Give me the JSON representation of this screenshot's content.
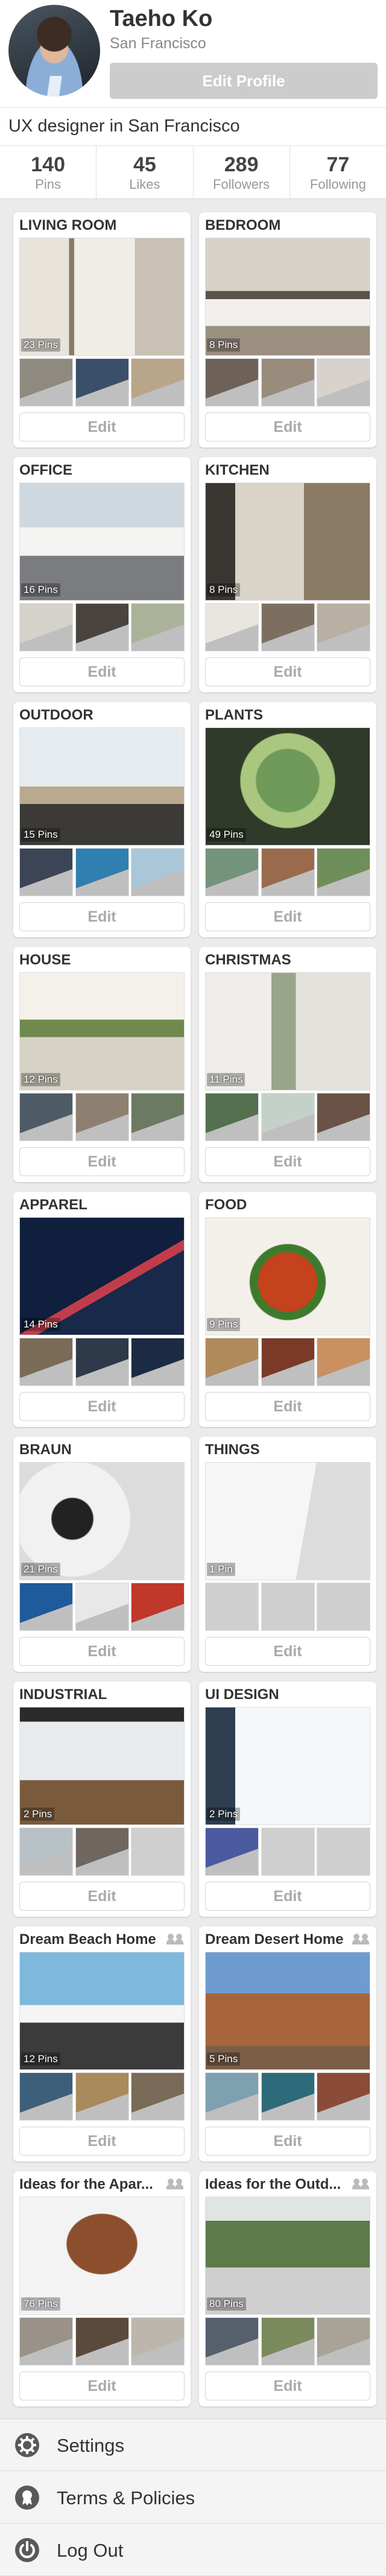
{
  "profile": {
    "name": "Taeho Ko",
    "location": "San Francisco",
    "edit_label": "Edit Profile",
    "bio": "UX designer in San Francisco"
  },
  "stats": [
    {
      "value": "140",
      "label": "Pins"
    },
    {
      "value": "45",
      "label": "Likes"
    },
    {
      "value": "289",
      "label": "Followers"
    },
    {
      "value": "77",
      "label": "Following"
    }
  ],
  "board_edit_label": "Edit",
  "boards": [
    {
      "title": "LIVING ROOM",
      "pins": "23 Pins",
      "collab": false
    },
    {
      "title": "BEDROOM",
      "pins": "8 Pins",
      "collab": false
    },
    {
      "title": "OFFICE",
      "pins": "16 Pins",
      "collab": false
    },
    {
      "title": "KITCHEN",
      "pins": "8 Pins",
      "collab": false
    },
    {
      "title": "OUTDOOR",
      "pins": "15 Pins",
      "collab": false
    },
    {
      "title": "PLANTS",
      "pins": "49 Pins",
      "collab": false
    },
    {
      "title": "HOUSE",
      "pins": "12 Pins",
      "collab": false
    },
    {
      "title": "CHRISTMAS",
      "pins": "11 Pins",
      "collab": false
    },
    {
      "title": "APPAREL",
      "pins": "14 Pins",
      "collab": false
    },
    {
      "title": "FOOD",
      "pins": "9 Pins",
      "collab": false
    },
    {
      "title": "BRAUN",
      "pins": "21 Pins",
      "collab": false
    },
    {
      "title": "THINGS",
      "pins": "1 Pin",
      "collab": false
    },
    {
      "title": "INDUSTRIAL",
      "pins": "2 Pins",
      "collab": false
    },
    {
      "title": "UI DESIGN",
      "pins": "2 Pins",
      "collab": false
    },
    {
      "title": "Dream Beach Home",
      "pins": "12 Pins",
      "collab": true
    },
    {
      "title": "Dream Desert Home",
      "pins": "5 Pins",
      "collab": true
    },
    {
      "title": "Ideas for the Apar...",
      "pins": "76 Pins",
      "collab": true
    },
    {
      "title": "Ideas for the Outd...",
      "pins": "80 Pins",
      "collab": true
    }
  ],
  "menu": [
    {
      "label": "Settings",
      "icon": "gear-icon"
    },
    {
      "label": "Terms & Policies",
      "icon": "badge-icon"
    },
    {
      "label": "Log Out",
      "icon": "power-icon"
    }
  ],
  "colors": {
    "background": "#ebebeb",
    "edit_profile_button": "#cccccc",
    "secondary_text": "#999999"
  }
}
